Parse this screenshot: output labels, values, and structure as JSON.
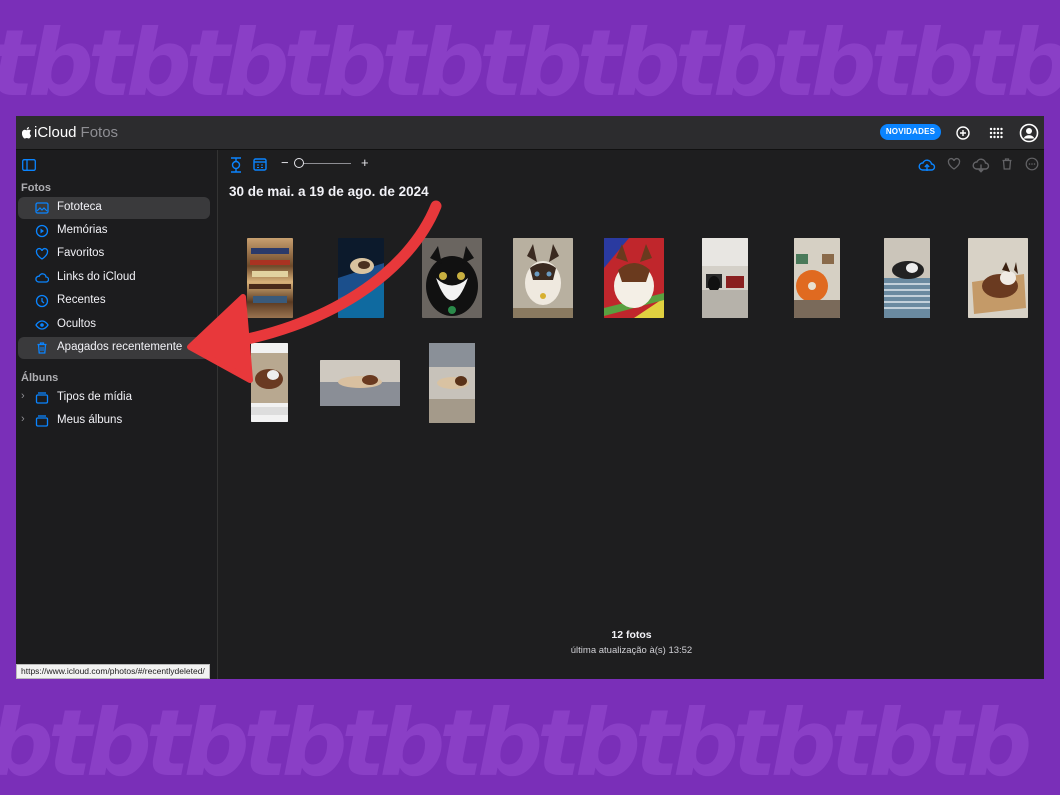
{
  "app": {
    "brand": "iCloud",
    "product": "Fotos"
  },
  "topbar": {
    "news_label": "NOVIDADES"
  },
  "sidebar": {
    "photos_section": "Fotos",
    "items": [
      {
        "label": "Fototeca",
        "icon": "library-icon"
      },
      {
        "label": "Memórias",
        "icon": "memories-icon"
      },
      {
        "label": "Favoritos",
        "icon": "heart-icon"
      },
      {
        "label": "Links do iCloud",
        "icon": "cloud-link-icon"
      },
      {
        "label": "Recentes",
        "icon": "clock-icon"
      },
      {
        "label": "Ocultos",
        "icon": "eye-icon"
      },
      {
        "label": "Apagados recentemente",
        "icon": "trash-icon"
      }
    ],
    "albums_section": "Álbuns",
    "albums": [
      {
        "label": "Tipos de mídia",
        "icon": "folder-icon"
      },
      {
        "label": "Meus álbuns",
        "icon": "folder-icon"
      }
    ]
  },
  "main": {
    "date_range": "30 de mai. a 19 de ago. de 2024",
    "photo_count": "12 fotos",
    "last_update": "última atualização à(s) 13:52"
  },
  "status_url": "https://www.icloud.com/photos/#/recentlydeleted/",
  "colors": {
    "accent": "#0a84ff",
    "arrow": "#e8383b",
    "background": "#7a2fb8"
  },
  "watermark": "tb"
}
